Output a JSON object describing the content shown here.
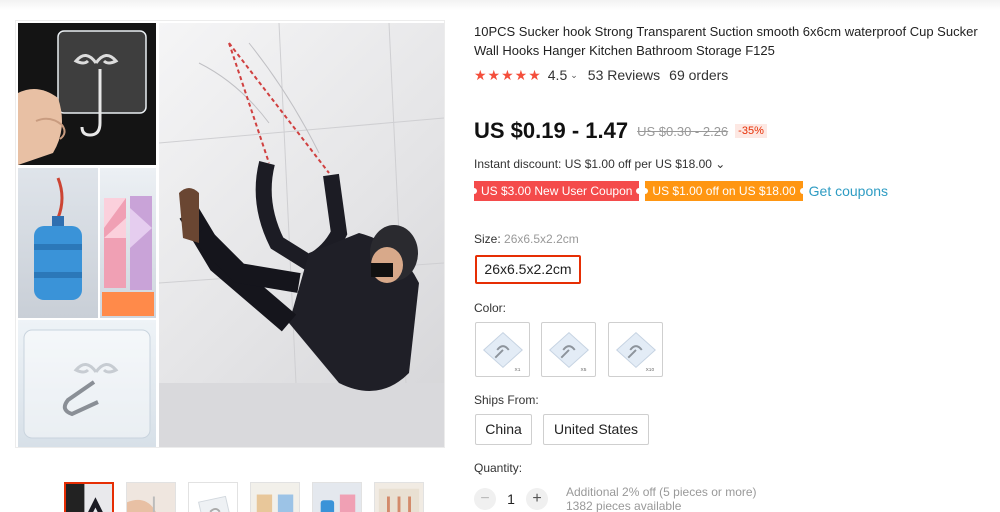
{
  "product": {
    "title": "10PCS Sucker hook Strong Transparent Suction smooth 6x6cm waterproof Cup Sucker Wall Hooks Hanger Kitchen Bathroom Storage F125",
    "rating": {
      "stars": "★★★★★",
      "value": "4.5",
      "chevron": "⌄",
      "reviews": "53 Reviews",
      "orders": "69 orders"
    },
    "price": {
      "current": "US $0.19 - 1.47",
      "original": "US $0.30 - 2.26",
      "discount": "-35%"
    },
    "instant_discount": "Instant discount: US $1.00 off per US $18.00 ⌄",
    "coupons": [
      {
        "label": "US $3.00 New User Coupon",
        "color": "#f44b4b"
      },
      {
        "label": "US $1.00 off on US $18.00",
        "color": "#ff9612"
      }
    ],
    "get_coupons": "Get coupons",
    "size": {
      "label": "Size:",
      "selected": "26x6.5x2.2cm",
      "option": "26x6.5x2.2cm"
    },
    "color": {
      "label": "Color:",
      "options": [
        "X1",
        "X5",
        "X10"
      ]
    },
    "ships_from": {
      "label": "Ships From:",
      "options": [
        "China",
        "United States"
      ]
    },
    "quantity": {
      "label": "Quantity:",
      "minus": "−",
      "plus": "+",
      "value": "1",
      "note": "Additional 2% off (5 pieces or more)",
      "available": "1382 pieces available"
    }
  },
  "theme": {
    "accent": "#e62e04",
    "star": "#f44e3b",
    "link": "#2e9cc3"
  }
}
